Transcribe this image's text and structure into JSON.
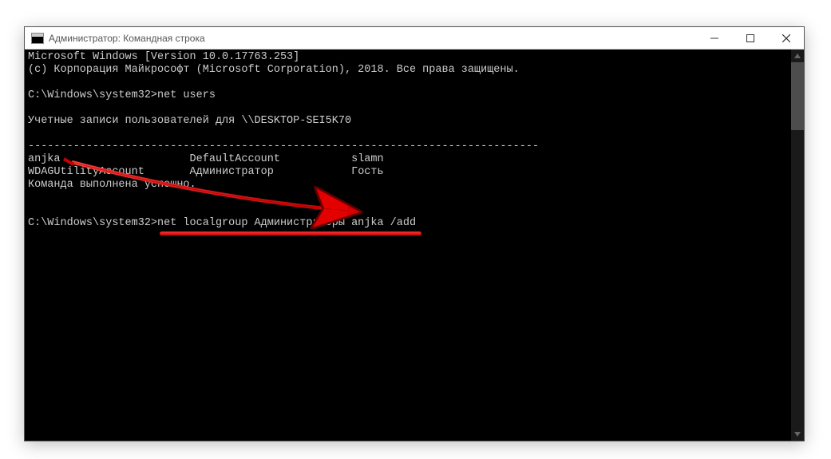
{
  "window": {
    "title": "Администратор: Командная строка"
  },
  "terminal": {
    "line1": "Microsoft Windows [Version 10.0.17763.253]",
    "line2": "(c) Корпорация Майкрософт (Microsoft Corporation), 2018. Все права защищены.",
    "blank1": "",
    "prompt1_path": "C:\\Windows\\system32>",
    "prompt1_cmd": "net users",
    "blank2": "",
    "accounts_header": "Учетные записи пользователей для \\\\DESKTOP-SEI5K70",
    "blank3": "",
    "separator": "-------------------------------------------------------------------------------",
    "row1_c1": "anjka",
    "row1_c2": "DefaultAccount",
    "row1_c3": "slamn",
    "row2_c1": "WDAGUtilityAccount",
    "row2_c2": "Администратор",
    "row2_c3": "Гость",
    "success": "Команда выполнена успешно.",
    "blank4": "",
    "blank5": "",
    "prompt2_path": "C:\\Windows\\system32>",
    "prompt2_cmd": "net localgroup Администраторы anjka /add"
  }
}
